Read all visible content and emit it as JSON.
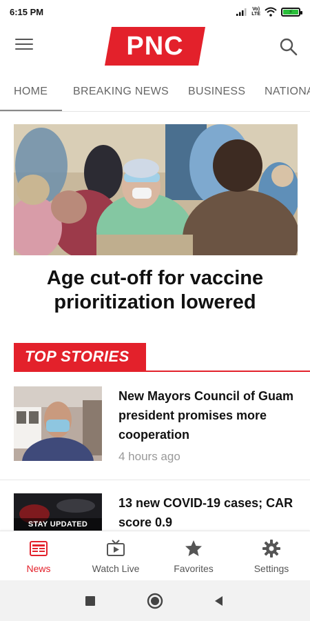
{
  "status_bar": {
    "time": "6:15 PM",
    "network_top": "Vo)",
    "network_bottom": "LTE"
  },
  "header": {
    "logo_text": "PNC",
    "brand_color": "#e3212b",
    "menu_icon": "hamburger-menu-icon",
    "search_icon": "search-icon"
  },
  "tabs": [
    {
      "label": "HOME",
      "active": true
    },
    {
      "label": "BREAKING NEWS",
      "active": false
    },
    {
      "label": "BUSINESS",
      "active": false
    },
    {
      "label": "NATIONAL",
      "active": false
    }
  ],
  "hero": {
    "title": "Age cut-off for vaccine prioritization lowered"
  },
  "section": {
    "label": "TOP STORIES"
  },
  "stories": [
    {
      "title": "New Mayors Council of Guam president promises more cooperation",
      "time": "4 hours ago",
      "thumb_label": ""
    },
    {
      "title": "13 new COVID-19 cases; CAR score 0.9",
      "time": "",
      "thumb_label": "STAY UPDATED"
    }
  ],
  "bottom_nav": [
    {
      "label": "News",
      "icon": "newspaper-icon",
      "active": true
    },
    {
      "label": "Watch Live",
      "icon": "tv-icon",
      "active": false
    },
    {
      "label": "Favorites",
      "icon": "star-icon",
      "active": false
    },
    {
      "label": "Settings",
      "icon": "gear-icon",
      "active": false
    }
  ],
  "system_nav": {
    "recents_icon": "square-recents-icon",
    "home_icon": "circle-home-icon",
    "back_icon": "triangle-back-icon"
  }
}
